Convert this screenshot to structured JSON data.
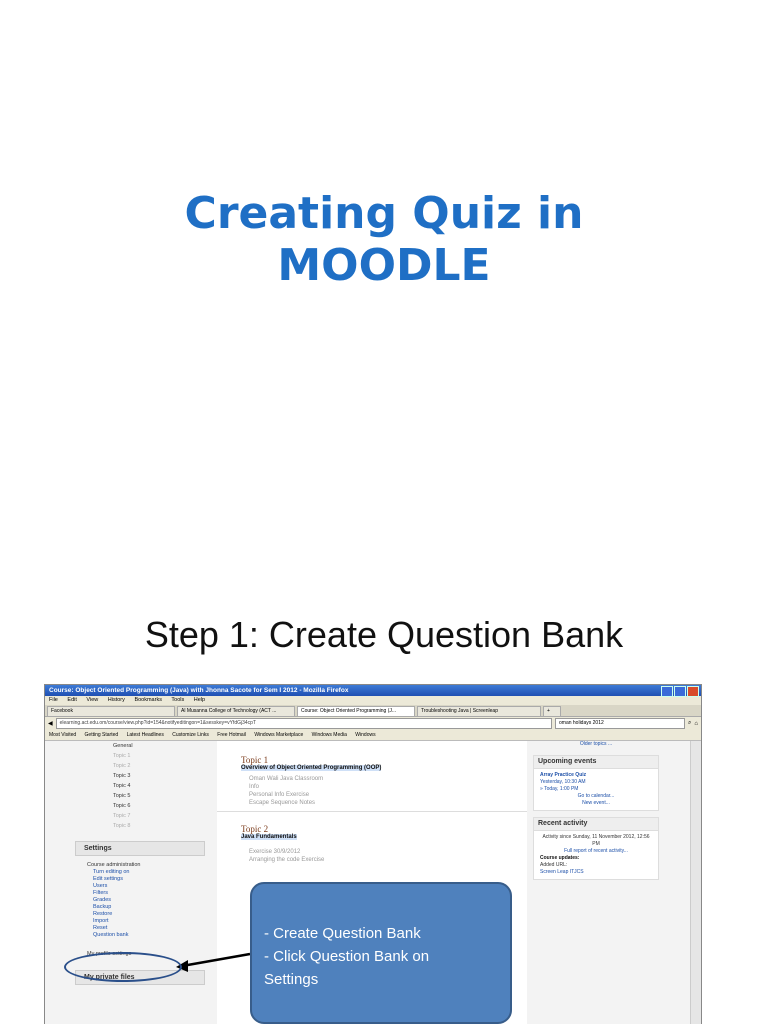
{
  "slide1": {
    "title_line1": "Creating Quiz in",
    "title_line2": "MOODLE"
  },
  "slide2": {
    "title": "Step 1: Create Question Bank",
    "callout": {
      "line1": "- Create Question Bank",
      "line2": "- Click Question Bank on",
      "line3": "Settings"
    }
  },
  "browser": {
    "window_title": "Course: Object Oriented Programming (Java) with Jhonna Sacote for Sem I 2012 - Mozilla Firefox",
    "menu": [
      "File",
      "Edit",
      "View",
      "History",
      "Bookmarks",
      "Tools",
      "Help"
    ],
    "tabs": [
      "Facebook",
      "Al Musanna College of Technology (ACT ...",
      "Course: Object Oriented Programming (J...",
      "Troubleshooting Java | Screenleap"
    ],
    "url": "elearning.act.edu.om/course/view.php?id=154&notifyeditingon=1&sesskey=vYfdGj34cpT",
    "search": "oman holidays 2012",
    "bookmarks": [
      "Most Visited",
      "Getting Started",
      "Latest Headlines",
      "Customize Links",
      "Free Hotmail",
      "Windows Marketplace",
      "Windows Media",
      "Windows"
    ]
  },
  "left": {
    "topics": [
      "General",
      "Topic 1",
      "Topic 2",
      "Topic 3",
      "Topic 4",
      "Topic 5",
      "Topic 6",
      "Topic 7",
      "Topic 8"
    ],
    "settings_header": "Settings",
    "course_admin": "Course administration",
    "admin_items": [
      "Turn editing on",
      "Edit settings",
      "Users",
      "Filters",
      "Grades",
      "Backup",
      "Restore",
      "Import",
      "Reset",
      "Question bank"
    ],
    "profile_settings": "My profile settings",
    "private_files_header": "My private files"
  },
  "main": {
    "topic1_head": "Topic 1",
    "topic1_title": "Overview of Object Oriented Programming (OOP)",
    "topic1_items": [
      "Oman Wali Java Classroom",
      "Info",
      "Personal Info Exercise",
      "Escape Sequence Notes"
    ],
    "topic2_head": "Topic 2",
    "topic2_title": "Java Fundamentals",
    "topic2_items": [
      "Exercise 30/9/2012",
      "Arranging the code Exercise"
    ]
  },
  "right": {
    "older_topics": "Older topics ...",
    "upcoming_header": "Upcoming events",
    "event_title": "Array Practice Quiz",
    "event_time": "Yesterday, 10:30 AM",
    "event_time2": "» Today, 1:00 PM",
    "goto_calendar": "Go to calendar...",
    "new_event": "New event...",
    "recent_header": "Recent activity",
    "activity_since": "Activity since Sunday, 11 November 2012, 12:56 PM",
    "full_report": "Full report of recent activity...",
    "course_updates": "Course updates:",
    "added_url": "Added URL:",
    "screen_leap": "Screen Leap ITJCS"
  }
}
